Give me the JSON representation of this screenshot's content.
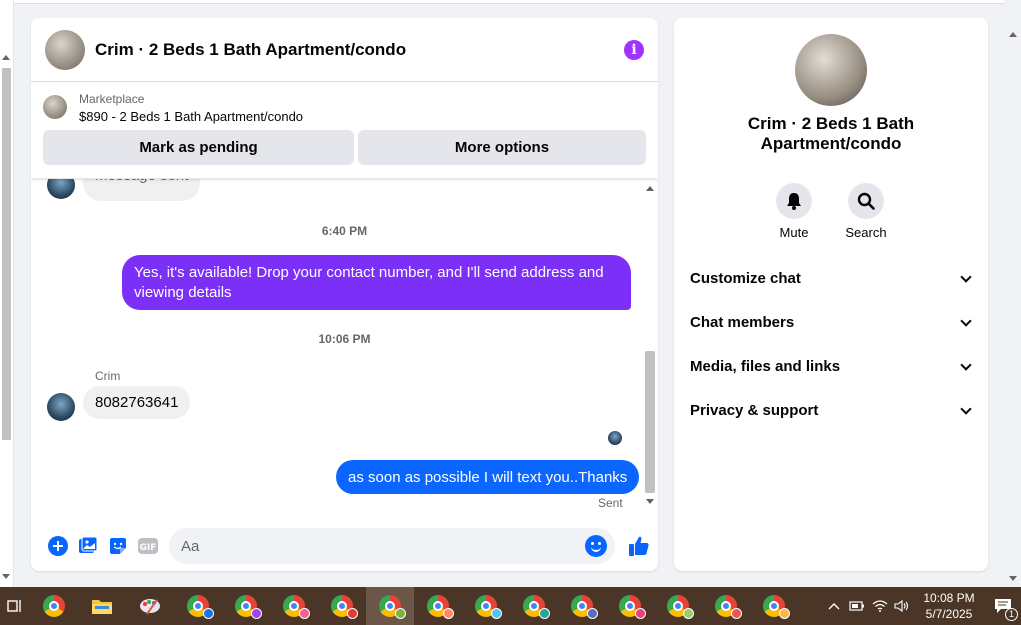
{
  "chat": {
    "title": "Crim · 2 Beds 1 Bath Apartment/condo",
    "marketplace_label": "Marketplace",
    "listing": "$890 - 2 Beds 1 Bath Apartment/condo",
    "mark_pending": "Mark as pending",
    "more_options": "More options"
  },
  "messages": {
    "partial_top": "Message sent",
    "time1": "6:40 PM",
    "out1": "Yes, it's available! Drop your contact number, and I'll send address and viewing details",
    "time2": "10:06 PM",
    "sender": "Crim",
    "in1": "8082763641",
    "out2": "as soon as possible I will text you..Thanks",
    "status": "Sent"
  },
  "composer": {
    "placeholder": "Aa"
  },
  "panel": {
    "title": "Crim · 2 Beds 1 Bath Apartment/condo",
    "mute": "Mute",
    "search": "Search",
    "sections": [
      "Customize chat",
      "Chat members",
      "Media, files and links",
      "Privacy & support"
    ]
  },
  "taskbar": {
    "time": "10:08 PM",
    "date": "5/7/2025",
    "notifications": "1"
  },
  "colors": {
    "outgoing_purple": "#7b2ff7",
    "outgoing_blue": "#0a66ff",
    "accent": "#0866ff",
    "info": "#a033ff"
  }
}
